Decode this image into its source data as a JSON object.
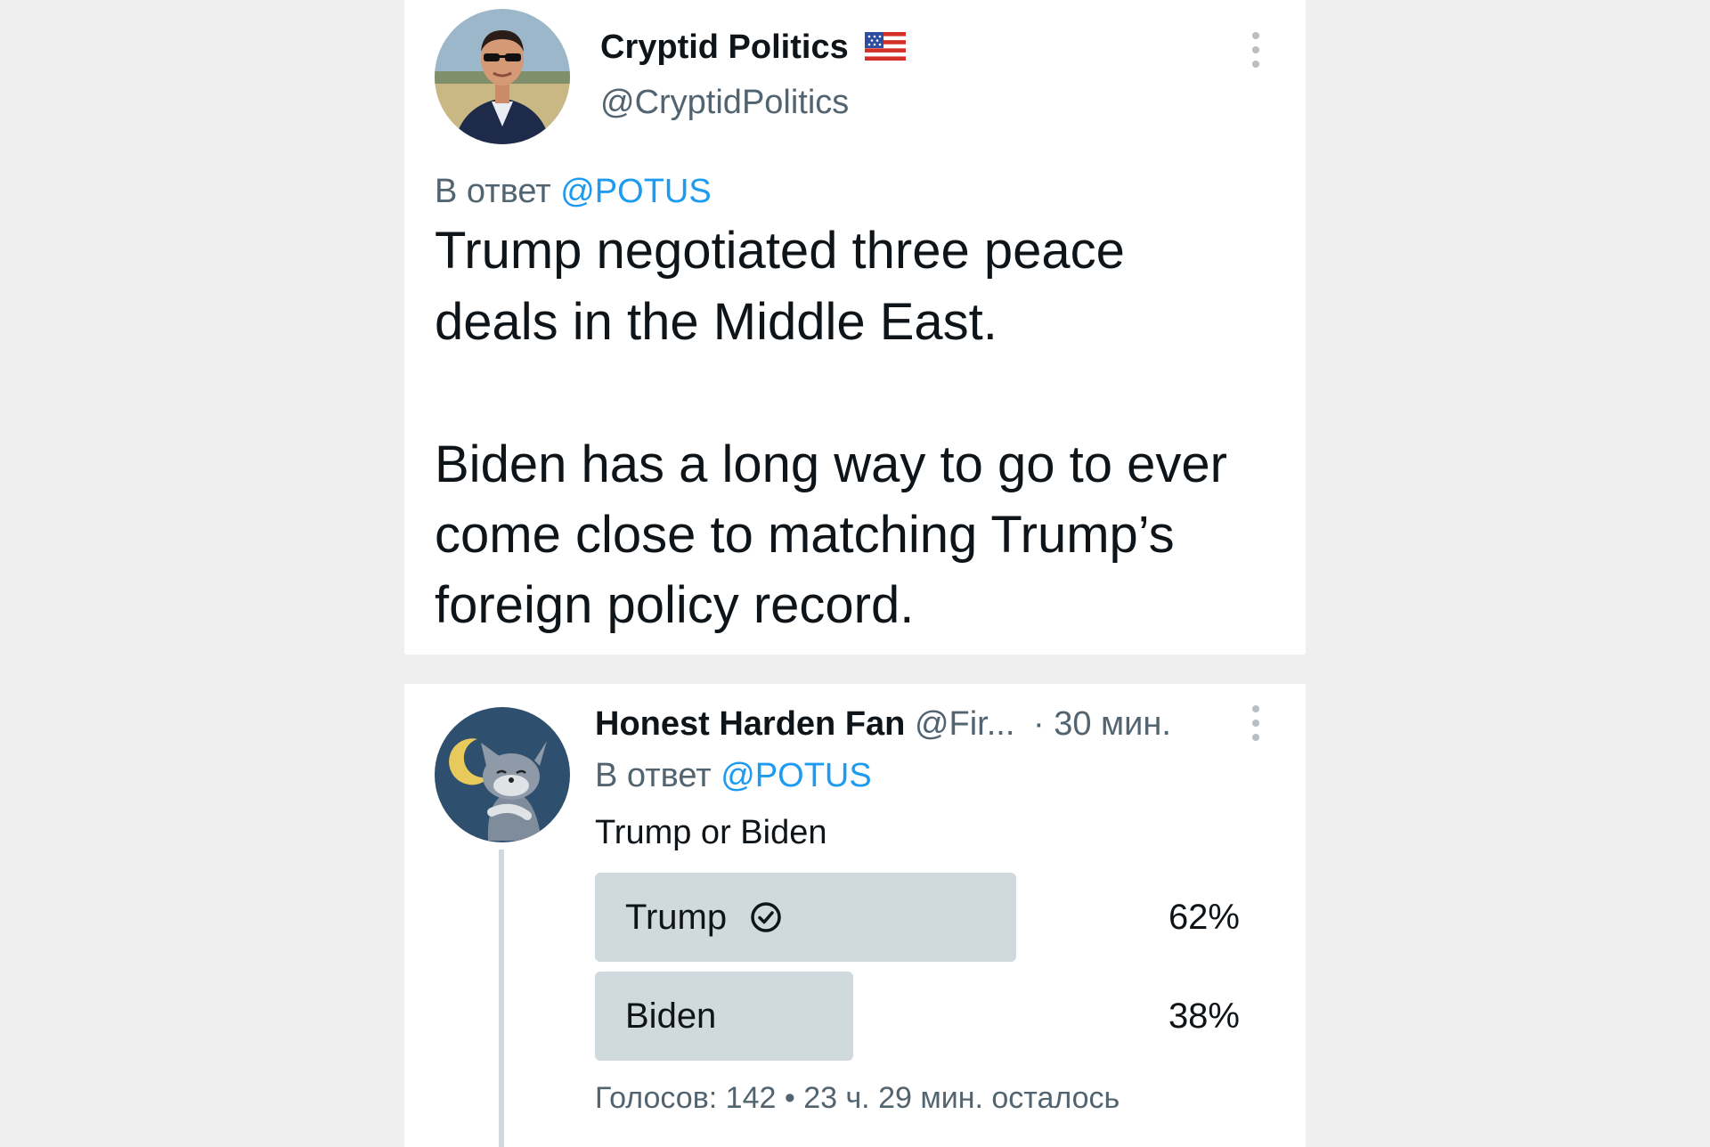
{
  "tweet": {
    "display_name": "Cryptid Politics",
    "handle": "@CryptidPolitics",
    "flag_icon": "us-flag-icon",
    "reply_prefix": "В ответ",
    "reply_mention": "@POTUS",
    "text_lines": [
      "Trump negotiated three peace",
      "deals in the Middle East.",
      "Biden has a long way to go to ever",
      "come close to matching Trump’s",
      "foreign policy record."
    ]
  },
  "reply": {
    "display_name": "Honest Harden Fan",
    "handle": "@Fir...",
    "time": "· 30 мин.",
    "reply_prefix": "В ответ",
    "reply_mention": "@POTUS",
    "text": "Trump or Biden",
    "poll": {
      "options": [
        {
          "label": "Trump",
          "percent_label": "62%",
          "fraction": 0.62,
          "winner": true
        },
        {
          "label": "Biden",
          "percent_label": "38%",
          "fraction": 0.38,
          "winner": false
        }
      ],
      "footer": "Голосов: 142 • 23 ч. 29 мин. осталось"
    }
  },
  "colors": {
    "background": "#efefef",
    "card": "#ffffff",
    "link": "#1d9bf0",
    "secondary_text": "#536471",
    "poll_bar": "#cfd9de",
    "thread_line": "#cfd9de"
  }
}
